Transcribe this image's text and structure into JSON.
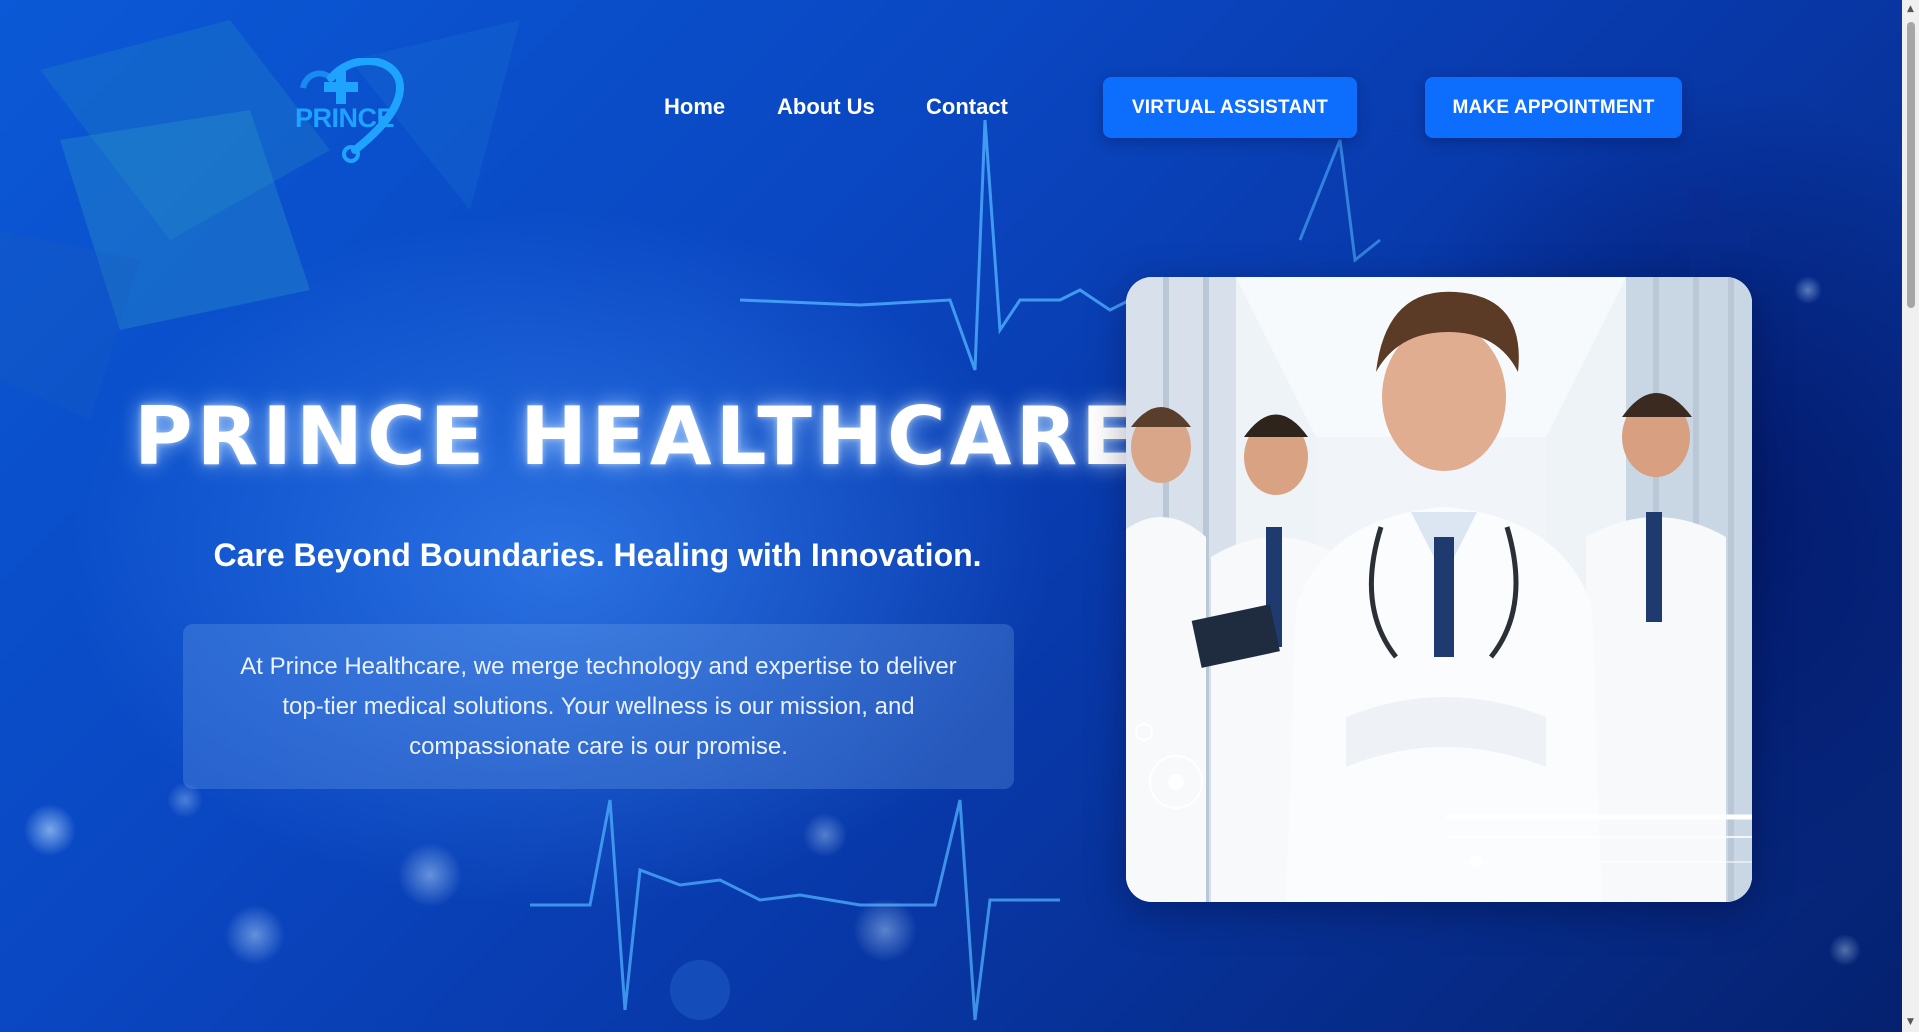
{
  "logo": {
    "text": "PRINCE",
    "icon": "medical-cross-heart-stethoscope-icon"
  },
  "nav": {
    "items": [
      {
        "label": "Home"
      },
      {
        "label": "About Us"
      },
      {
        "label": "Contact"
      }
    ],
    "virtual_assistant_label": "VIRTUAL ASSISTANT",
    "appointment_label": "MAKE APPOINTMENT"
  },
  "hero": {
    "title": "PRINCE HEALTHCARE",
    "tagline": "Care Beyond Boundaries.  Healing with Innovation.",
    "description": "At Prince Healthcare, we merge technology and expertise to deliver top-tier medical solutions. Your wellness is our mission, and compassionate care is our promise.",
    "image": "team-of-smiling-doctors-photo"
  },
  "colors": {
    "accent": "#0d6efd",
    "background": "#0a47c2",
    "logo": "#1ea3ff",
    "heartbeat": "#4fb0ff"
  },
  "scrollbar": {
    "up_arrow": "▲",
    "down_arrow": "▼"
  }
}
